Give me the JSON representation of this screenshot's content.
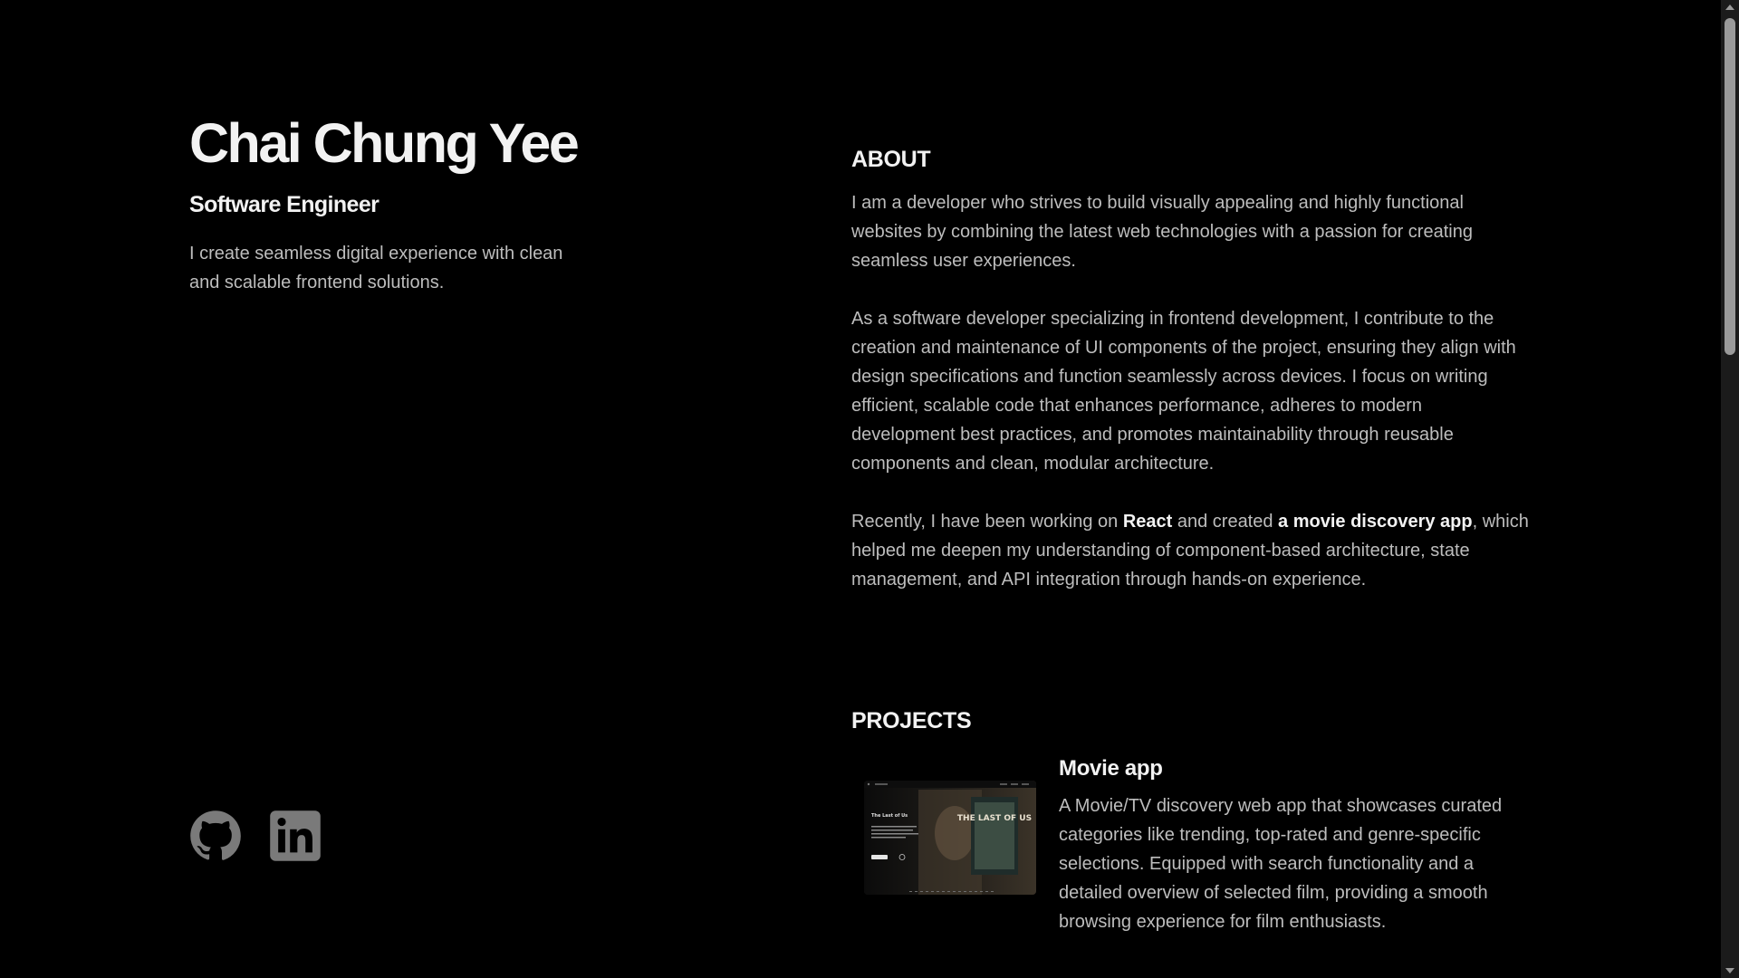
{
  "profile": {
    "name": "Chai Chung Yee",
    "role": "Software Engineer",
    "tagline": "I create seamless digital experience with clean and scalable frontend solutions."
  },
  "socials": [
    {
      "label": "GitHub",
      "icon": "github-icon"
    },
    {
      "label": "LinkedIn",
      "icon": "linkedin-icon"
    }
  ],
  "about": {
    "heading": "ABOUT",
    "p1": "I am a developer who strives to build visually appealing and highly functional websites by combining the latest web technologies with a passion for creating seamless user experiences.",
    "p2": "As a software developer specializing in frontend development, I contribute to the creation and maintenance of UI components of the project, ensuring they align with design specifications and function seamlessly across devices. I focus on writing efficient, scalable code that enhances performance, adheres to modern development best practices, and promotes maintainability through reusable components and clean, modular architecture.",
    "p3": {
      "before": "Recently, I have been working on ",
      "react": "React",
      "middle": " and created ",
      "app": "a movie discovery app",
      "after": ", which helped me deepen my understanding of component-based architecture, state management, and API integration through hands-on experience."
    }
  },
  "projects": {
    "heading": "PROJECTS",
    "items": [
      {
        "title": "Movie app",
        "description": "A Movie/TV discovery web app that showcases curated categories like trending, top-rated and genre-specific selections. Equipped with search functionality and a detailed overview of selected film, providing a smooth browsing experience for film enthusiasts.",
        "thumbnail_caption": "The Last of Us",
        "poster_text": "THE LAST OF US"
      }
    ]
  },
  "colors": {
    "background": "#000000",
    "heading": "#f2f2f2",
    "body_text": "#bdbdbd",
    "icon": "#7a7a7a"
  }
}
